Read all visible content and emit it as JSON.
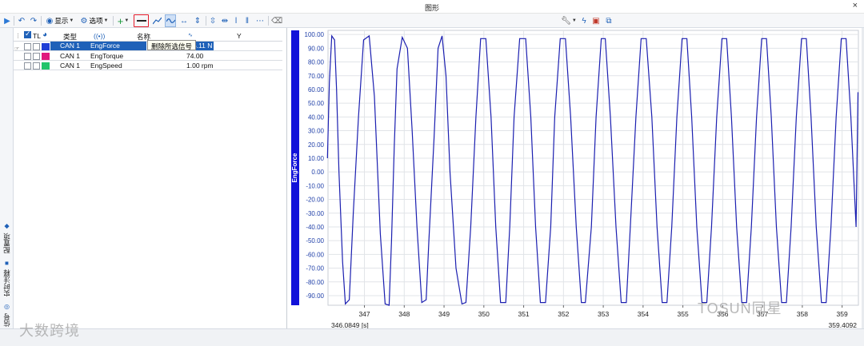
{
  "window": {
    "title": "图形",
    "close_glyph": "×"
  },
  "toolbar": {
    "play_icon": "play-icon",
    "undo_icon": "undo-icon",
    "redo_icon": "redo-icon",
    "display_label": "显示",
    "options_label": "选项",
    "add_icon": "plus-icon",
    "remove_icon": "minus-icon"
  },
  "tooltip": {
    "text": "删除所选信号"
  },
  "side_tabs": {
    "config": "配置项",
    "annotation": "实时注释",
    "signal": "信号"
  },
  "table": {
    "headers": {
      "tl": "TL",
      "type": "类型",
      "name": "名称",
      "y": "Y"
    },
    "rows": [
      {
        "channel": "CAN 1",
        "name": "EngForce",
        "value": "5.11 N",
        "color": "#1f3fd6",
        "selected": true
      },
      {
        "channel": "CAN 1",
        "name": "EngTorque",
        "value": "74.00",
        "color": "#e0197d",
        "selected": false
      },
      {
        "channel": "CAN 1",
        "name": "EngSpeed",
        "value": "1.00 rpm",
        "color": "#21c46a",
        "selected": false
      }
    ]
  },
  "chart_data": {
    "type": "line",
    "title": "",
    "ylabel": "EngForce",
    "xlabel": "",
    "x_unit_label": "[s]",
    "x_start_label": "346.0849",
    "x_end_label": "359.4092",
    "xlim": [
      346.0849,
      359.4092
    ],
    "ylim": [
      -97,
      103
    ],
    "yticks": [
      100,
      90,
      80,
      70,
      60,
      50,
      40,
      30,
      20,
      10,
      0,
      -10,
      -20,
      -30,
      -40,
      -50,
      -60,
      -70,
      -80,
      -90
    ],
    "xticks": [
      347,
      348,
      349,
      350,
      351,
      352,
      353,
      354,
      355,
      356,
      357,
      358,
      359
    ],
    "grid": true,
    "series": [
      {
        "color": "#1b1fb0",
        "x": [
          346.07,
          346.12,
          346.18,
          346.25,
          346.3,
          346.36,
          346.45,
          346.52,
          346.62,
          346.72,
          346.85,
          346.98,
          347.12,
          347.25,
          347.4,
          347.52,
          347.62,
          347.68,
          347.75,
          347.82,
          347.95,
          348.08,
          348.2,
          348.32,
          348.44,
          348.55,
          348.62,
          348.75,
          348.85,
          348.95,
          349.05,
          349.15,
          349.3,
          349.45,
          349.55,
          349.67,
          349.8,
          349.92,
          350.05,
          350.18,
          350.3,
          350.42,
          350.55,
          350.65,
          350.76,
          350.9,
          351.05,
          351.18,
          351.3,
          351.42,
          351.55,
          351.68,
          351.78,
          351.92,
          352.05,
          352.18,
          352.32,
          352.45,
          352.55,
          352.7,
          352.82,
          352.95,
          353.05,
          353.18,
          353.32,
          353.45,
          353.58,
          353.68,
          353.82,
          353.95,
          354.08,
          354.22,
          354.35,
          354.48,
          354.6,
          354.72,
          354.85,
          354.98,
          355.1,
          355.22,
          355.35,
          355.48,
          355.6,
          355.72,
          355.85,
          355.98,
          356.1,
          356.22,
          356.35,
          356.48,
          356.6,
          356.72,
          356.85,
          356.98,
          357.1,
          357.22,
          357.35,
          357.48,
          357.6,
          357.72,
          357.85,
          357.98,
          358.1,
          358.22,
          358.35,
          358.48,
          358.6,
          358.72,
          358.85,
          358.98,
          359.1,
          359.22,
          359.35,
          359.4
        ],
        "y": [
          10,
          65,
          99,
          96,
          60,
          0,
          -65,
          -96,
          -93,
          -30,
          40,
          96,
          99,
          55,
          -45,
          -96,
          -97,
          -50,
          20,
          75,
          98,
          90,
          30,
          -40,
          -95,
          -93,
          -50,
          25,
          90,
          99,
          70,
          0,
          -70,
          -96,
          -95,
          -40,
          40,
          97,
          97,
          40,
          -40,
          -95,
          -95,
          -40,
          40,
          97,
          97,
          40,
          -40,
          -95,
          -95,
          -40,
          40,
          97,
          97,
          40,
          -40,
          -95,
          -95,
          -40,
          40,
          97,
          97,
          40,
          -40,
          -95,
          -95,
          -40,
          40,
          97,
          97,
          40,
          -40,
          -95,
          -95,
          -40,
          40,
          97,
          97,
          40,
          -40,
          -95,
          -95,
          -40,
          40,
          97,
          97,
          40,
          -40,
          -95,
          -95,
          -40,
          40,
          97,
          97,
          40,
          -40,
          -95,
          -95,
          -40,
          40,
          97,
          97,
          40,
          -40,
          -95,
          -95,
          -40,
          40,
          97,
          97,
          40,
          -40,
          58
        ]
      }
    ]
  },
  "watermarks": {
    "left": "大数跨境",
    "right": "TOSUN同星"
  }
}
